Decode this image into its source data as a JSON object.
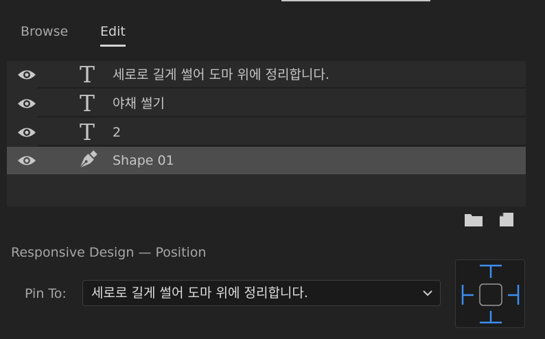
{
  "tabs": [
    {
      "label": "Browse",
      "active": false
    },
    {
      "label": "Edit",
      "active": true
    }
  ],
  "layers": [
    {
      "label": "세로로 길게 썰어 도마 위에 정리합니다.",
      "type": "text",
      "icon": "text-layer-icon",
      "visible": true,
      "selected": false
    },
    {
      "label": "야채 썰기",
      "type": "text",
      "icon": "text-layer-icon",
      "visible": true,
      "selected": false
    },
    {
      "label": "2",
      "type": "text",
      "icon": "text-layer-icon",
      "visible": true,
      "selected": false
    },
    {
      "label": "Shape 01",
      "type": "shape",
      "icon": "pen-tool-icon",
      "visible": true,
      "selected": true
    }
  ],
  "text_icon_glyph": "T",
  "toolbar": {
    "folder_icon": "folder-icon",
    "new_item_icon": "new-item-icon"
  },
  "responsive": {
    "title": "Responsive Design — Position",
    "pin_label": "Pin To:",
    "pin_value": "세로로 길게 썰어 도마 위에 정리합니다."
  },
  "colors": {
    "background": "#222222",
    "panel": "#2a2a2a",
    "selected_row": "#4d4d4d",
    "accent_blue": "#3d8ef0"
  }
}
